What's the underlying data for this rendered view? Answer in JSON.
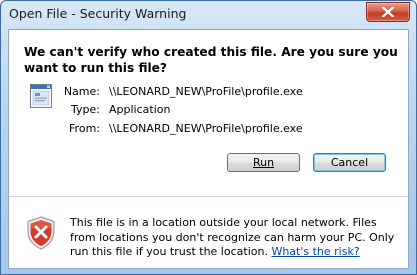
{
  "window": {
    "title": "Open File - Security Warning"
  },
  "dialog": {
    "question": "We can't verify who created this file. Are you sure you want to run this file?",
    "fields": [
      {
        "label": "Name:",
        "value": "\\\\LEONARD_NEW\\ProFile\\profile.exe"
      },
      {
        "label": "Type:",
        "value": "Application"
      },
      {
        "label": "From:",
        "value": "\\\\LEONARD_NEW\\ProFile\\profile.exe"
      }
    ],
    "buttons": {
      "run": "Run",
      "cancel": "Cancel"
    },
    "warning": {
      "text": "This file is in a location outside your local network. Files from locations you don't recognize can harm your PC. Only run this file if you trust the location.",
      "link": "What's the risk?"
    }
  },
  "colors": {
    "close_button": "#c33e21",
    "link": "#0645ad",
    "default_button_border": "#3c7fb1"
  },
  "icons": [
    "close-icon",
    "application-file-icon",
    "shield-warning-icon"
  ]
}
